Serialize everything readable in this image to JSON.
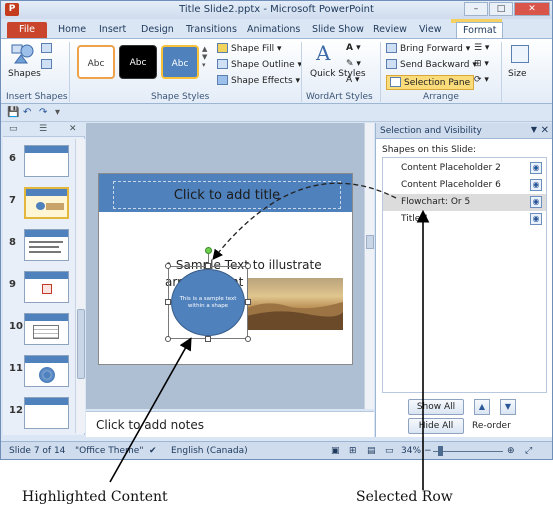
{
  "window": {
    "title": "Title Slide2.pptx - Microsoft PowerPoint",
    "qat_letter": "P"
  },
  "tabs": [
    "File",
    "Home",
    "Insert",
    "Design",
    "Transitions",
    "Animations",
    "Slide Show",
    "Review",
    "View",
    "Format"
  ],
  "ribbon": {
    "shapes_label": "Shapes",
    "insert_shapes": "Insert Shapes",
    "style_swatches": [
      "Abc",
      "Abc",
      "Abc"
    ],
    "shape_fill": "Shape Fill",
    "shape_outline": "Shape Outline",
    "shape_effects": "Shape Effects",
    "shape_styles": "Shape Styles",
    "quick_styles": "Quick Styles",
    "wordart_styles": "WordArt Styles",
    "bring_forward": "Bring Forward",
    "send_backward": "Send Backward",
    "selection_pane": "Selection Pane",
    "arrange": "Arrange",
    "size": "Size"
  },
  "thumbnails": [
    "6",
    "7",
    "8",
    "9",
    "10",
    "11",
    "12"
  ],
  "slide": {
    "title_placeholder": "Click to add title",
    "bullet_text": "Sample Text to illustrate arrangement",
    "shape_text": "This is a sample text within a shape"
  },
  "notes": "Click to add notes",
  "selection_pane": {
    "title": "Selection and Visibility",
    "shapes_on_slide": "Shapes on this Slide:",
    "shapes": [
      "Content Placeholder 2",
      "Content Placeholder 6",
      "Flowchart: Or 5",
      "Title 1"
    ],
    "selected_index": 2,
    "show_all": "Show All",
    "hide_all": "Hide All",
    "reorder": "Re-order"
  },
  "status": {
    "slide_info": "Slide 7 of 14",
    "theme": "\"Office Theme\"",
    "language": "English (Canada)",
    "zoom": "34%"
  },
  "annotations": {
    "left": "Highlighted Content",
    "right": "Selected Row"
  }
}
